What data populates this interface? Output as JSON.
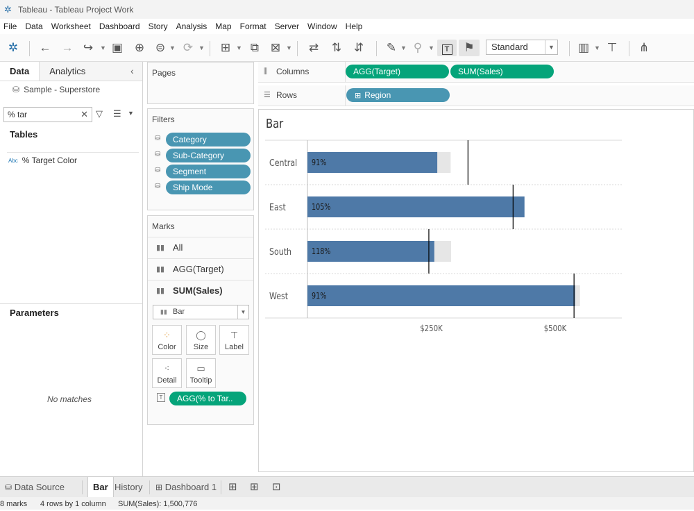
{
  "window": {
    "title": "Tableau - Tableau Project Work"
  },
  "menu": [
    "File",
    "Data",
    "Worksheet",
    "Dashboard",
    "Story",
    "Analysis",
    "Map",
    "Format",
    "Server",
    "Window",
    "Help"
  ],
  "toolbar": {
    "fit_mode": "Standard"
  },
  "data_pane": {
    "tabs": [
      "Data",
      "Analytics"
    ],
    "datasource": "Sample - Superstore",
    "search_value": "% tar",
    "tables_heading": "Tables",
    "fields": [
      {
        "type": "Abc",
        "name": "% Target Color"
      }
    ],
    "parameters_heading": "Parameters",
    "parameters_empty": "No matches"
  },
  "pages_card": {
    "title": "Pages"
  },
  "filters_card": {
    "title": "Filters",
    "pills": [
      "Category",
      "Sub-Category",
      "Segment",
      "Ship Mode"
    ]
  },
  "marks_card": {
    "title": "Marks",
    "layers": [
      "All",
      "AGG(Target)",
      "SUM(Sales)"
    ],
    "mark_type": "Bar",
    "buttons": [
      "Color",
      "Size",
      "Label",
      "Detail",
      "Tooltip"
    ],
    "label_pill": "AGG(% to Tar.."
  },
  "shelves": {
    "columns_label": "Columns",
    "columns_pills": [
      "AGG(Target)",
      "SUM(Sales)"
    ],
    "rows_label": "Rows",
    "rows_pills": [
      "Region"
    ]
  },
  "sheet": {
    "title": "Bar"
  },
  "chart_data": {
    "type": "bar",
    "title": "Bar",
    "categories": [
      "Central",
      "East",
      "South",
      "West"
    ],
    "series": [
      {
        "name": "AGG(Target)",
        "values": [
          289000,
          435000,
          290000,
          550000
        ]
      },
      {
        "name": "SUM(Sales)",
        "values": [
          262000,
          438000,
          256000,
          540000
        ]
      }
    ],
    "reference_lines": [
      324000,
      415000,
      245000,
      538000
    ],
    "data_labels": [
      "91%",
      "105%",
      "118%",
      "91%"
    ],
    "x_ticks": [
      "$250K",
      "$500K"
    ],
    "x_tick_values": [
      250000,
      500000
    ],
    "xlim": [
      0,
      563000
    ],
    "xlabel": "",
    "ylabel": "",
    "colors": {
      "sales": "#4e79a7",
      "target": "#e6e6e6",
      "ref_line": "#000000"
    }
  },
  "tabs": {
    "items": [
      "Data Source",
      "Bar",
      "History",
      "Dashboard 1"
    ],
    "active": "Bar"
  },
  "status": {
    "marks": "8 marks",
    "rows_cols": "4 rows by 1 column",
    "sum": "SUM(Sales): 1,500,776"
  }
}
